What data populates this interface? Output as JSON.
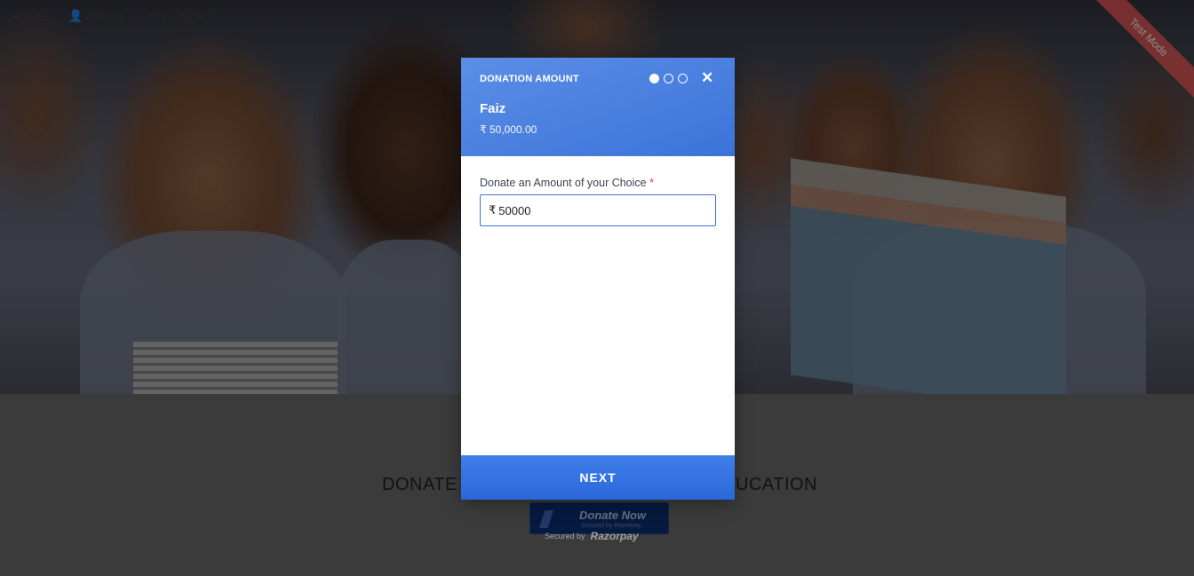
{
  "nav": {
    "home": "HOME",
    "about": "ABOUT",
    "contact": "CONTACT",
    "about_icon": "user-icon",
    "contact_icon": "mail-icon"
  },
  "ribbon": "Test Mode",
  "page": {
    "headline_left": "DONATE",
    "headline_right": "UCATION",
    "donate_button": "Donate Now",
    "donate_button_sub": "Secured by Razorpay",
    "secured_label": "Secured by",
    "secured_brand": "Razorpay"
  },
  "modal": {
    "header_label": "DONATION AMOUNT",
    "close": "✕",
    "payee": "Faiz",
    "amount_display": "₹ 50,000.00",
    "steps_total": 3,
    "steps_current": 1,
    "field_label": "Donate an Amount of your Choice",
    "required_mark": "*",
    "currency_symbol": "₹",
    "amount_value": "50000",
    "next_label": "NEXT"
  },
  "colors": {
    "header_blue": "#3b73d9",
    "button_blue": "#2a68da",
    "ribbon_red": "#d9534f",
    "required_red": "#e03b3b"
  }
}
